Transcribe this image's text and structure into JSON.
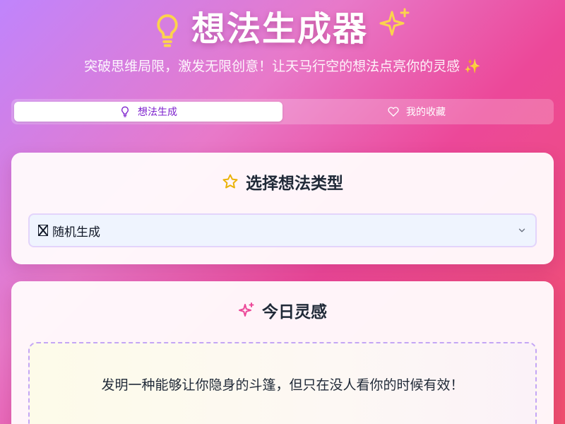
{
  "app": {
    "title": "想法生成器",
    "subtitle": "突破思维局限，激发无限创意！让天马行空的想法点亮你的灵感 ✨"
  },
  "tabs": [
    {
      "label": "想法生成",
      "icon": "lightbulb-icon",
      "active": true
    },
    {
      "label": "我的收藏",
      "icon": "heart-icon",
      "active": false
    }
  ],
  "type_section": {
    "heading": "选择想法类型",
    "icon": "star-icon",
    "select_value": "随机生成"
  },
  "inspiration_section": {
    "heading": "今日灵感",
    "icon": "sparkle-icon",
    "idea_text": "发明一种能够让你隐身的斗篷，但只在没人看你的时候有效！"
  },
  "colors": {
    "accent_purple": "#7e22ce",
    "bulb_yellow": "#fcd34d",
    "star_yellow": "#eab308",
    "sparkle_pink": "#ec4899",
    "dashed_border": "#c4a6f5"
  }
}
